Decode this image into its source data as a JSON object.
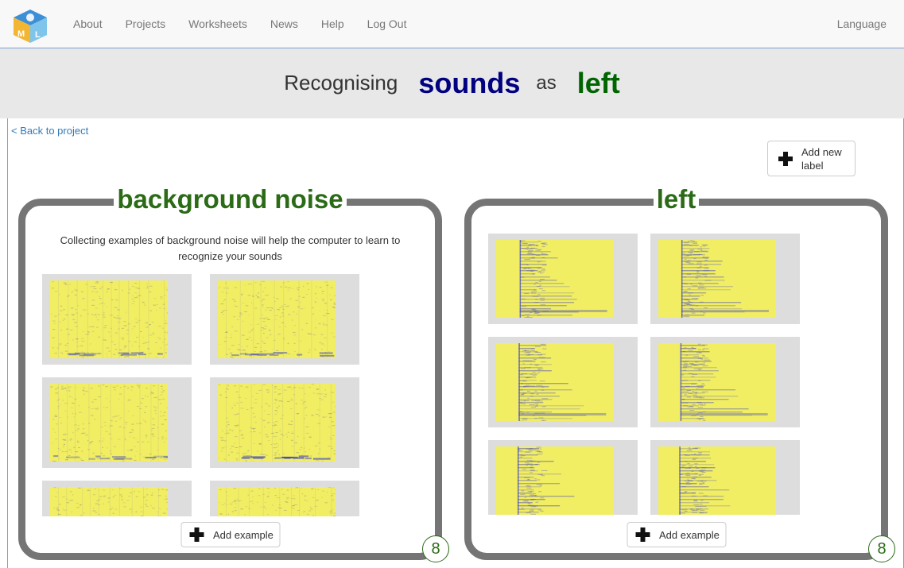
{
  "nav": {
    "links": [
      "About",
      "Projects",
      "Worksheets",
      "News",
      "Help",
      "Log Out"
    ],
    "language": "Language"
  },
  "title": {
    "prefix": "Recognising",
    "keyword1": "sounds",
    "middle": "as",
    "keyword2": "left"
  },
  "back_link": "< Back to project",
  "add_label_button": "Add new label",
  "colors": {
    "accent_blue": "#000080",
    "accent_green": "#006400",
    "panel_border": "#757575",
    "spectrogram_yellow": "#f1ee63",
    "spectrogram_blue": "#3b3fc4"
  },
  "labels": [
    {
      "name": "background noise",
      "description": "Collecting examples of background noise will help the computer to learn to recognize your sounds",
      "add_example": "Add example",
      "count": "8"
    },
    {
      "name": "left",
      "add_example": "Add example",
      "count": "8"
    }
  ]
}
